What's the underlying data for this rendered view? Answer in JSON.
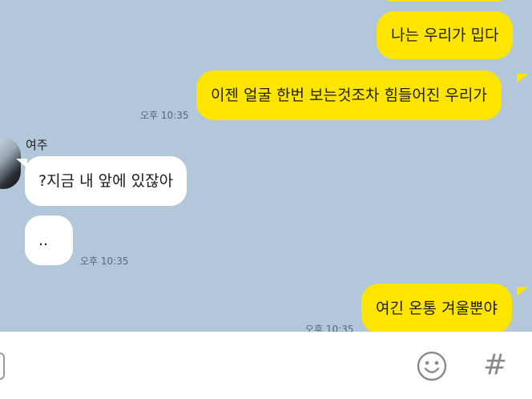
{
  "conversation": {
    "partner_name": "여주",
    "messages": [
      {
        "sender": "me",
        "text": "나는 우리가 밉다"
      },
      {
        "sender": "me",
        "text": "이젠 얼굴 한번 보는것조차 힘들어진 우리가",
        "time": "오후 10:35"
      },
      {
        "sender": "partner",
        "text": "?지금 내 앞에 있잖아"
      },
      {
        "sender": "partner",
        "text": "..",
        "time": "오후 10:35"
      },
      {
        "sender": "me",
        "text": "여긴 온통 겨울뿐야",
        "time": "오후 10:35"
      }
    ]
  },
  "composer": {
    "emoji_icon": "emoji-smile-icon",
    "hashtag_icon": "hashtag-icon",
    "hashtag_glyph": "#"
  },
  "colors": {
    "chat_background": "#b2c7da",
    "my_bubble": "#fee500",
    "partner_bubble": "#ffffff"
  }
}
